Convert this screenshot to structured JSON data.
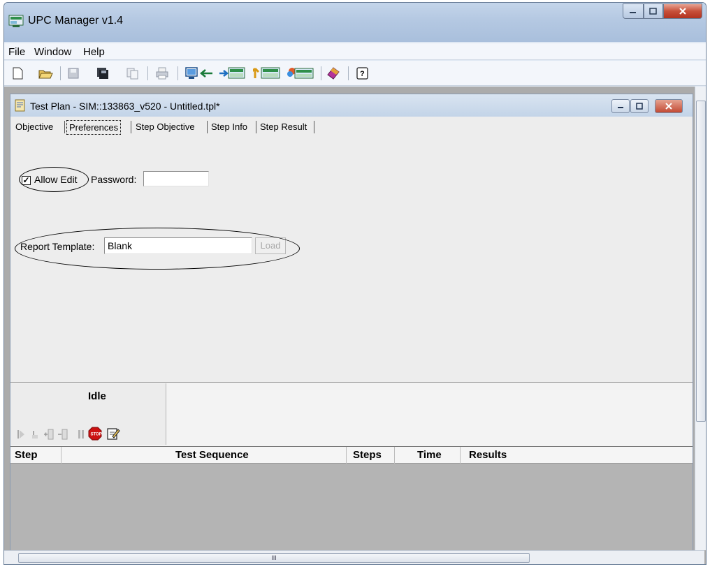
{
  "app": {
    "title": "UPC Manager v1.4"
  },
  "menubar": {
    "items": [
      {
        "label": "File"
      },
      {
        "label": "Window"
      },
      {
        "label": "Help"
      }
    ]
  },
  "toolbar": {
    "icons": [
      "new-file-icon",
      "open-folder-icon",
      "save-icon",
      "save-all-icon",
      "copy-icon",
      "print-icon",
      "import-icon",
      "export-icon",
      "transfer-icon",
      "upload-icon",
      "book-icon",
      "help-icon"
    ]
  },
  "child_window": {
    "title": "Test Plan - SIM::133863_v520 - Untitled.tpl*",
    "tabs": [
      {
        "label": "Objective"
      },
      {
        "label": "Preferences"
      },
      {
        "label": "Step Objective"
      },
      {
        "label": "Step Info"
      },
      {
        "label": "Step Result"
      }
    ],
    "active_tab": "Preferences"
  },
  "preferences": {
    "allow_edit_label": "Allow Edit",
    "allow_edit_checked": true,
    "check_mark": "✓",
    "password_label": "Password:",
    "password_value": "",
    "report_template_label": "Report Template:",
    "report_template_value": "Blank",
    "load_label": "Load"
  },
  "status": {
    "text": "Idle"
  },
  "results_table": {
    "columns": [
      "Step",
      "Test Sequence",
      "Steps",
      "Time",
      "Results"
    ],
    "rows": []
  },
  "scrollbar": {
    "grip": "III"
  },
  "colors": {
    "titlebar": "#b4c8e2",
    "close_button": "#c7503a",
    "stop_sign": "#cc1111",
    "table_empty": "#b4b4b4"
  }
}
